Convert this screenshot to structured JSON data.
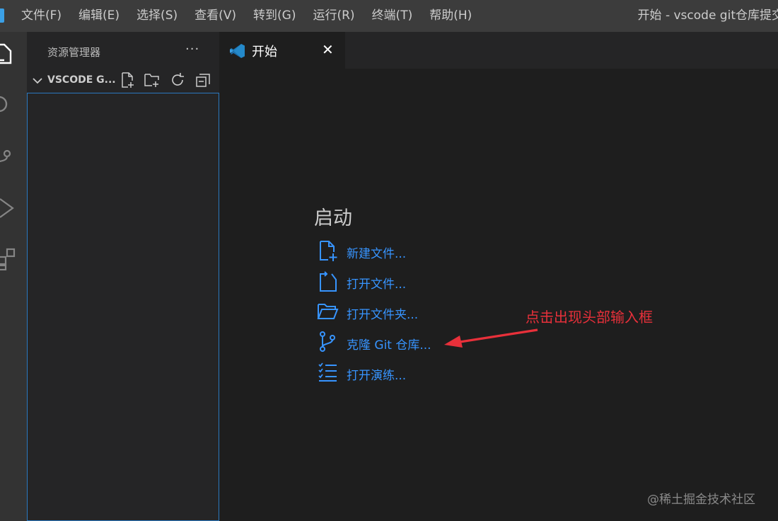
{
  "menu": {
    "items": [
      "文件(F)",
      "编辑(E)",
      "选择(S)",
      "查看(V)",
      "转到(G)",
      "运行(R)",
      "终端(T)",
      "帮助(H)"
    ],
    "window_title": "开始 - vscode git仓库提交"
  },
  "activity_bar": {
    "icons": [
      "explorer-icon",
      "search-icon",
      "source-control-icon",
      "run-debug-icon",
      "extensions-icon"
    ]
  },
  "sidebar": {
    "title": "资源管理器",
    "more_label": "···",
    "section_title": "VSCODE G...",
    "section_actions": [
      "new-file-icon",
      "new-folder-icon",
      "refresh-icon",
      "collapse-all-icon"
    ]
  },
  "tabs": [
    {
      "label": "开始",
      "close": "✕"
    }
  ],
  "welcome": {
    "start_heading": "启动",
    "links": [
      {
        "label": "新建文件...",
        "icon": "new-file-icon"
      },
      {
        "label": "打开文件...",
        "icon": "open-file-icon"
      },
      {
        "label": "打开文件夹...",
        "icon": "open-folder-icon"
      },
      {
        "label": "克隆 Git 仓库...",
        "icon": "git-branch-icon"
      },
      {
        "label": "打开演练...",
        "icon": "checklist-icon"
      }
    ]
  },
  "annotation": {
    "text": "点击出现头部输入框",
    "color": "#e8303a"
  },
  "watermark": "@稀土掘金技术社区",
  "colors": {
    "accent": "#3794ff",
    "titlebar": "#3c3c3c",
    "activitybar": "#333333",
    "sidebar": "#252526",
    "editor": "#1e1e1e"
  }
}
